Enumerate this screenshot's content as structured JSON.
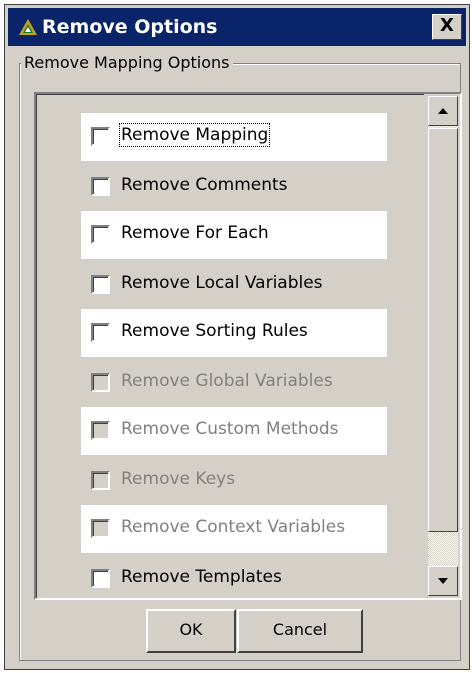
{
  "window": {
    "title": "Remove Options",
    "close_glyph": "X",
    "title_icon": "app-triangle-icon"
  },
  "group": {
    "legend": "Remove Mapping Options"
  },
  "items": [
    {
      "label": "Remove Mapping",
      "checked": false,
      "enabled": true,
      "focused": true
    },
    {
      "label": "Remove Comments",
      "checked": false,
      "enabled": true,
      "focused": false
    },
    {
      "label": "Remove For Each",
      "checked": false,
      "enabled": true,
      "focused": false
    },
    {
      "label": "Remove Local Variables",
      "checked": false,
      "enabled": true,
      "focused": false
    },
    {
      "label": "Remove Sorting Rules",
      "checked": false,
      "enabled": true,
      "focused": false
    },
    {
      "label": "Remove Global Variables",
      "checked": false,
      "enabled": false,
      "focused": false
    },
    {
      "label": "Remove Custom Methods",
      "checked": false,
      "enabled": false,
      "focused": false
    },
    {
      "label": "Remove Keys",
      "checked": false,
      "enabled": false,
      "focused": false
    },
    {
      "label": "Remove Context Variables",
      "checked": false,
      "enabled": false,
      "focused": false
    },
    {
      "label": "Remove Templates",
      "checked": false,
      "enabled": true,
      "focused": false
    }
  ],
  "buttons": {
    "ok_label": "OK",
    "cancel_label": "Cancel"
  },
  "colors": {
    "titlebar": "#0a246a",
    "face": "#d4d0c8",
    "disabled_text": "#808080"
  }
}
